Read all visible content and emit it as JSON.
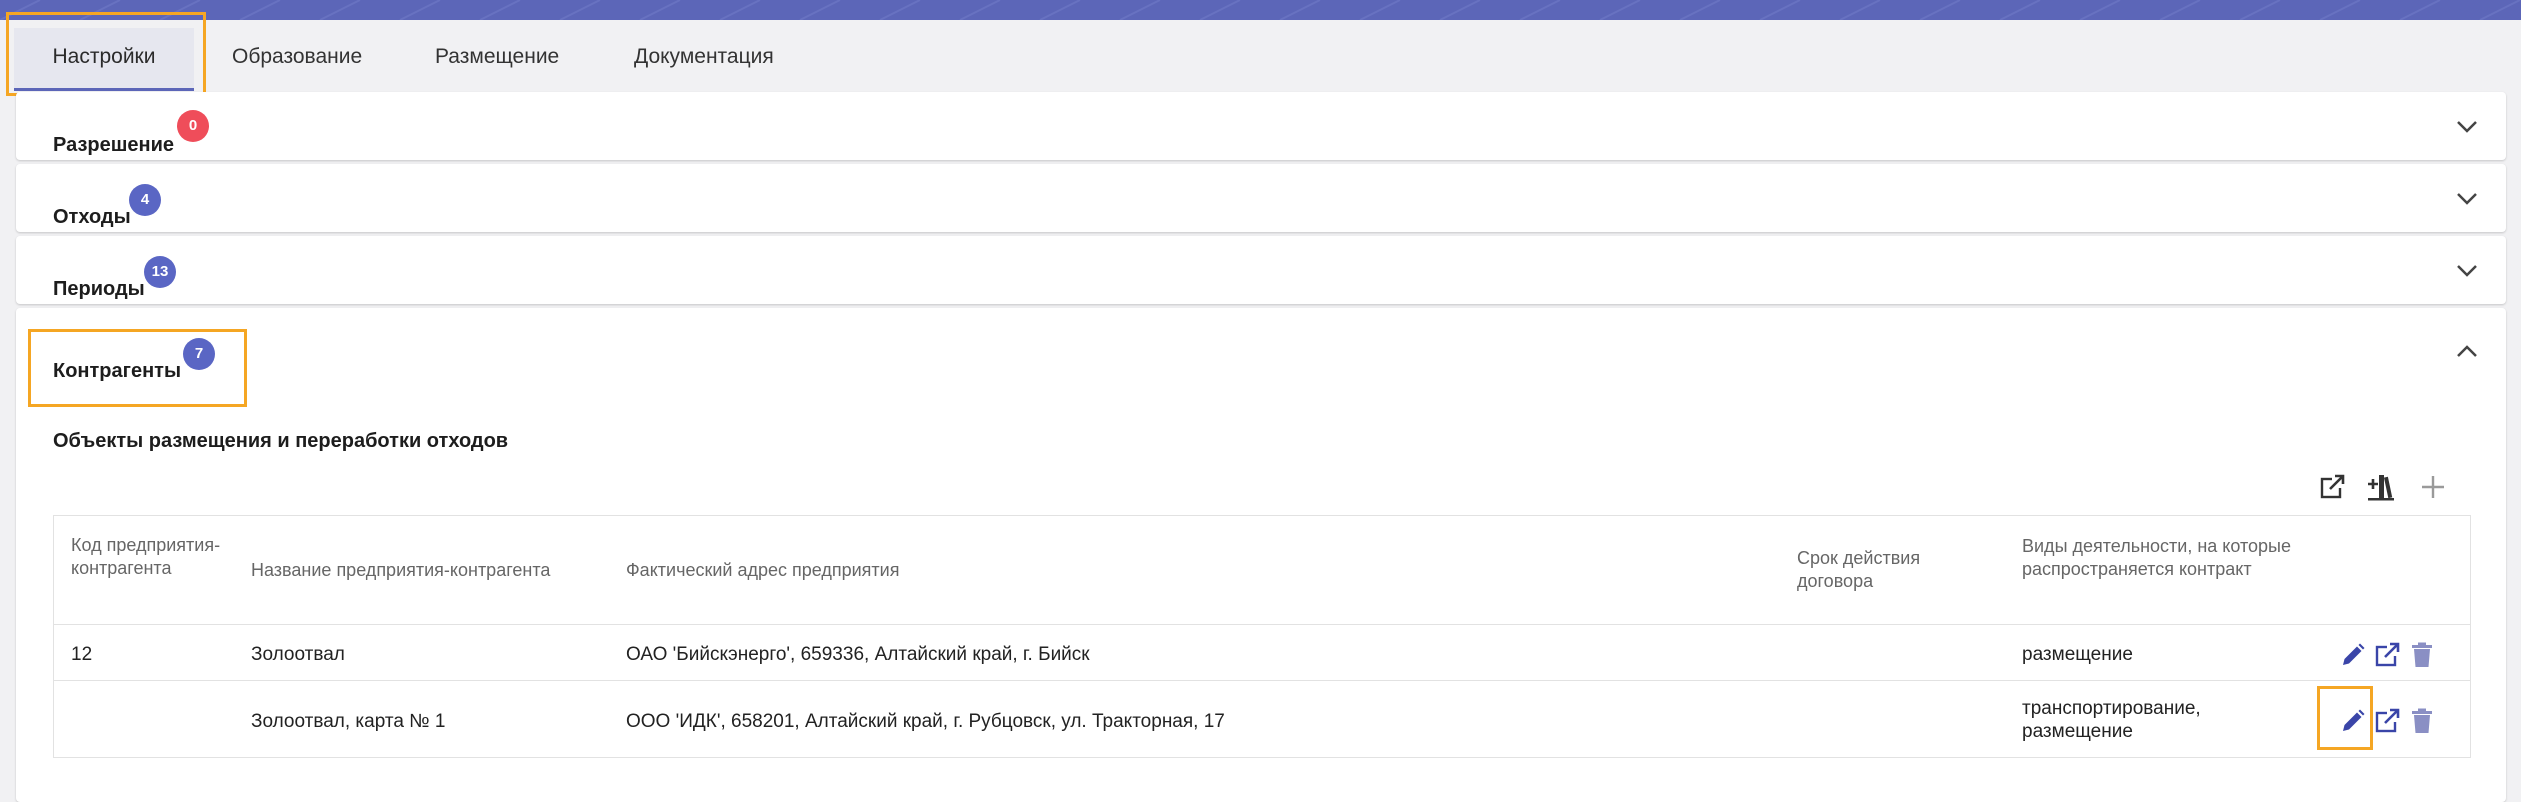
{
  "tabs": [
    {
      "label": "Настройки",
      "active": true
    },
    {
      "label": "Образование"
    },
    {
      "label": "Размещение"
    },
    {
      "label": "Документация"
    }
  ],
  "accordion": [
    {
      "title": "Разрешение",
      "count": "0",
      "badge_color": "#ef4d5a",
      "expanded": false
    },
    {
      "title": "Отходы",
      "count": "4",
      "badge_color": "#5a66c4",
      "expanded": false
    },
    {
      "title": "Периоды",
      "count": "13",
      "badge_color": "#5a66c4",
      "expanded": false
    },
    {
      "title": "Контрагенты",
      "count": "7",
      "badge_color": "#5a66c4",
      "expanded": true
    }
  ],
  "section": {
    "title": "Объекты размещения и переработки отходов",
    "toolbar": [
      "export-icon",
      "library-add-icon",
      "plus-icon"
    ]
  },
  "table": {
    "columns": [
      "Код предприятия-контрагента",
      "Название предприятия-контрагента",
      "Фактический адрес предприятия",
      "Срок действия договора",
      "Виды деятельности, на которые распространяется контракт"
    ],
    "rows": [
      {
        "code": "12",
        "name": "Золоотвал",
        "address": "ОАО 'Бийскэнерго', 659336, Алтайский край, г. Бийск",
        "term": "",
        "activity": "размещение"
      },
      {
        "code": "",
        "name": "Золоотвал, карта № 1",
        "address": "ООО 'ИДК', 658201, Алтайский край, г. Рубцовск, ул. Тракторная, 17",
        "term": "",
        "activity": "транспортирование, размещение"
      }
    ],
    "row_actions": [
      "edit-icon",
      "open-external-icon",
      "delete-icon"
    ]
  },
  "colors": {
    "accent": "#5c66b8",
    "highlight": "#f5a623",
    "icon": "#3a45a8"
  }
}
